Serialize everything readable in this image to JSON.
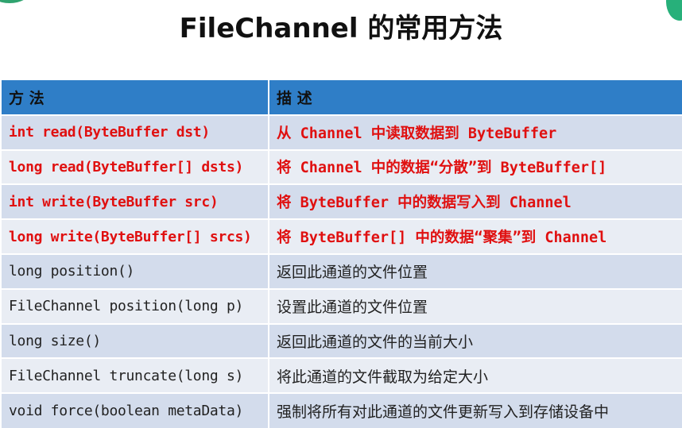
{
  "title": "FileChannel 的常用方法",
  "table": {
    "headers": [
      "方  法",
      "描  述"
    ],
    "rows": [
      {
        "method": "int read(ByteBuffer dst)",
        "description": "从 Channel 中读取数据到 ByteBuffer",
        "highlight": true
      },
      {
        "method": "long read(ByteBuffer[] dsts)",
        "description": "将 Channel 中的数据“分散”到 ByteBuffer[]",
        "highlight": true
      },
      {
        "method": "int write(ByteBuffer src)",
        "description": "将 ByteBuffer 中的数据写入到 Channel",
        "highlight": true
      },
      {
        "method": "long write(ByteBuffer[] srcs)",
        "description": "将 ByteBuffer[] 中的数据“聚集”到 Channel",
        "highlight": true
      },
      {
        "method": "long position()",
        "description": "返回此通道的文件位置",
        "highlight": false
      },
      {
        "method": "FileChannel position(long p)",
        "description": "设置此通道的文件位置",
        "highlight": false
      },
      {
        "method": "long size()",
        "description": "返回此通道的文件的当前大小",
        "highlight": false
      },
      {
        "method": "FileChannel truncate(long s)",
        "description": "将此通道的文件截取为给定大小",
        "highlight": false
      },
      {
        "method": "void force(boolean metaData)",
        "description": "强制将所有对此通道的文件更新写入到存储设备中",
        "highlight": false
      }
    ]
  },
  "colors": {
    "header_bg": "#2f7ec7",
    "row_odd": "#d3dcec",
    "row_even": "#e9edf4",
    "highlight_text": "#e01010"
  }
}
